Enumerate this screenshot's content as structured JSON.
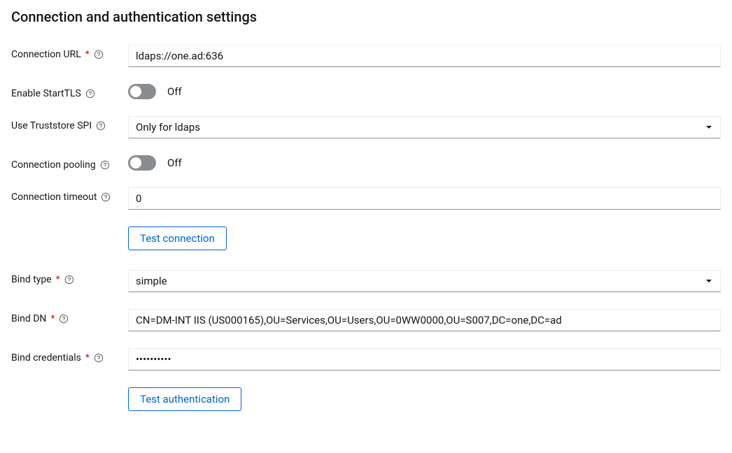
{
  "section_title": "Connection and authentication settings",
  "fields": {
    "connection_url": {
      "label": "Connection URL",
      "value": "ldaps://one.ad:636"
    },
    "enable_starttls": {
      "label": "Enable StartTLS",
      "state": "Off"
    },
    "use_truststore_spi": {
      "label": "Use Truststore SPI",
      "value": "Only for ldaps"
    },
    "connection_pooling": {
      "label": "Connection pooling",
      "state": "Off"
    },
    "connection_timeout": {
      "label": "Connection timeout",
      "value": "0"
    },
    "bind_type": {
      "label": "Bind type",
      "value": "simple"
    },
    "bind_dn": {
      "label": "Bind DN",
      "value": "CN=DM-INT IIS (US000165),OU=Services,OU=Users,OU=0WW0000,OU=S007,DC=one,DC=ad"
    },
    "bind_credentials": {
      "label": "Bind credentials",
      "value": "••••••••••"
    }
  },
  "buttons": {
    "test_connection": "Test connection",
    "test_authentication": "Test authentication"
  },
  "required_marker": "*"
}
